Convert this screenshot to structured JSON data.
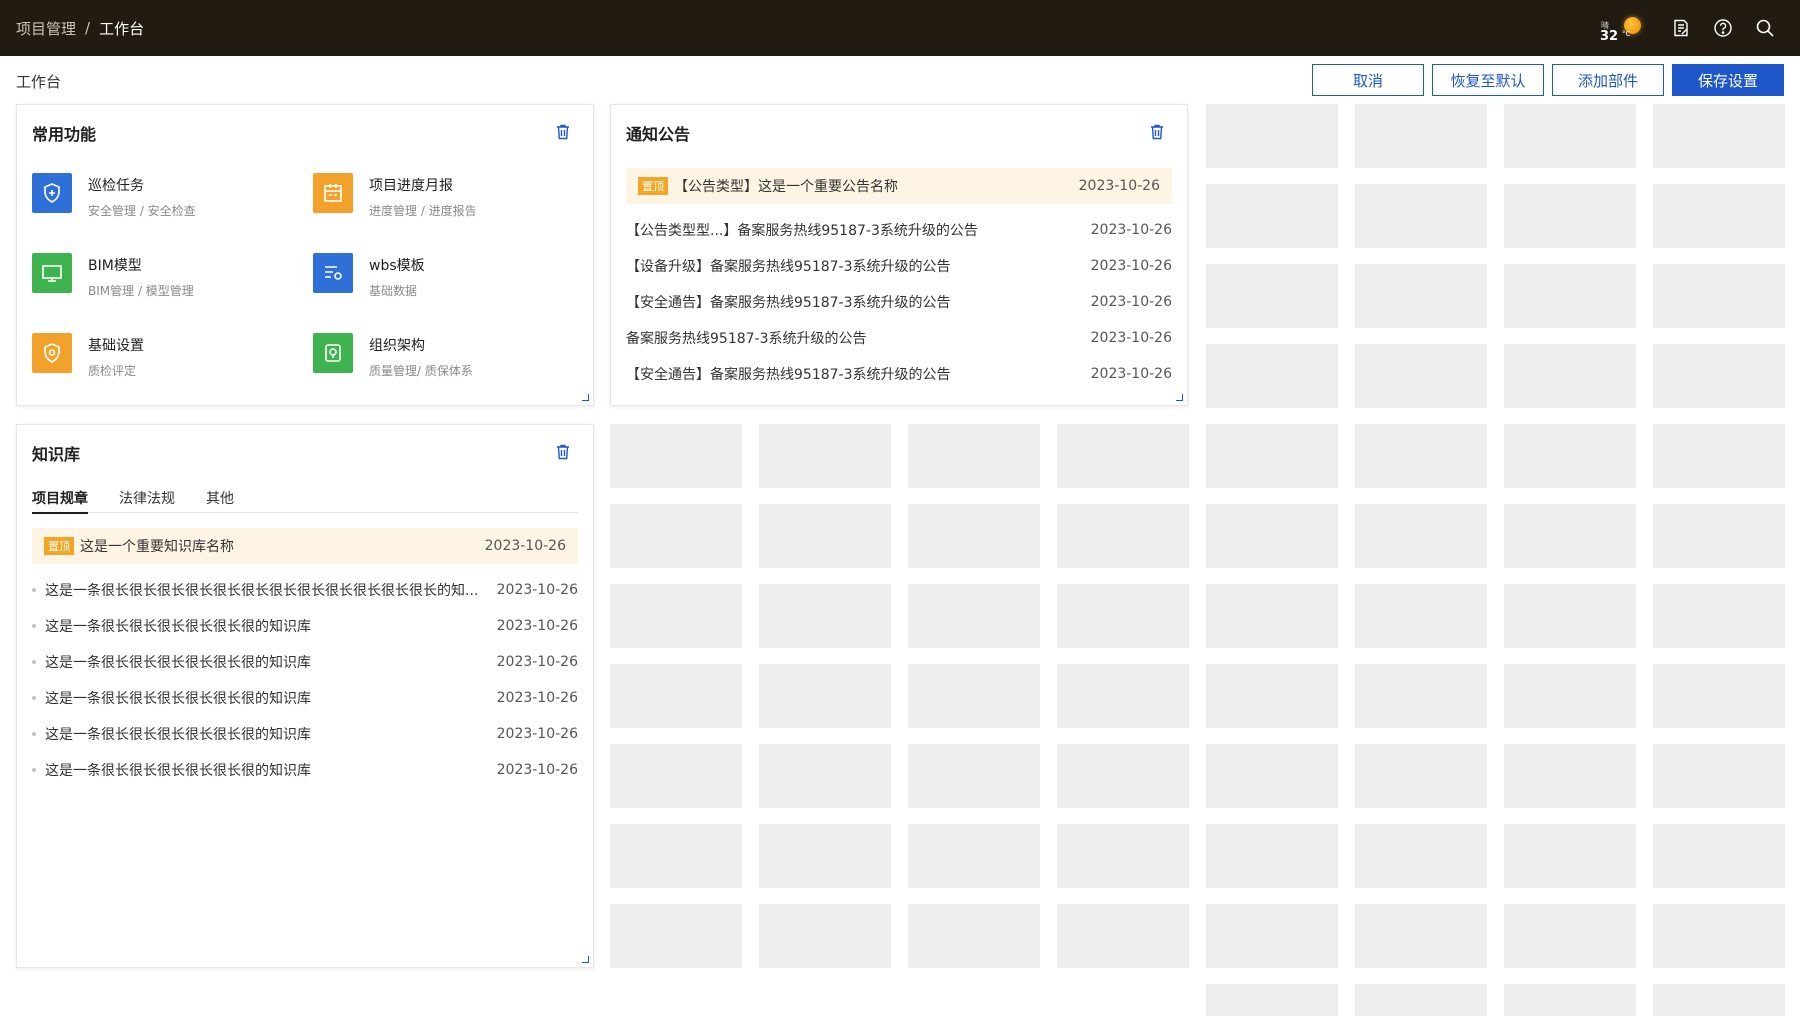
{
  "breadcrumb": {
    "parent": "项目管理",
    "separator": "/",
    "current": "工作台"
  },
  "weather": {
    "condition": "晴",
    "temperature": "32",
    "unit": "°C"
  },
  "topbar_icons": [
    "notes-icon",
    "help-icon",
    "search-icon"
  ],
  "page_title": "工作台",
  "actions": {
    "cancel": "取消",
    "reset": "恢复至默认",
    "add_widget": "添加部件",
    "save": "保存设置"
  },
  "colors": {
    "accent": "#1e58c8",
    "topbar": "#211b12",
    "pin_tag": "#f3a525",
    "pin_bg": "#fdf4e3",
    "placeholder": "#eeeeee"
  },
  "common_functions": {
    "title": "常用功能",
    "items": [
      {
        "name": "巡检任务",
        "sub": "安全管理 / 安全检查",
        "icon": "shield-icon",
        "color": "#2f6fd8"
      },
      {
        "name": "项目进度月报",
        "sub": "进度管理 / 进度报告",
        "icon": "calendar-icon",
        "color": "#f2a12b"
      },
      {
        "name": "BIM模型",
        "sub": "BIM管理 / 模型管理",
        "icon": "monitor-icon",
        "color": "#3fb34f"
      },
      {
        "name": "wbs模板",
        "sub": "基础数据",
        "icon": "settings-list-icon",
        "color": "#2f6fd8"
      },
      {
        "name": "基础设置",
        "sub": "质检评定",
        "icon": "settings-badge-icon",
        "color": "#f2a12b"
      },
      {
        "name": "组织架构",
        "sub": "质量管理/ 质保体系",
        "icon": "org-shield-icon",
        "color": "#3fb34f"
      }
    ]
  },
  "notices": {
    "title": "通知公告",
    "pinned": {
      "tag": "置顶",
      "text": "【公告类型】这是一个重要公告名称",
      "date": "2023-10-26"
    },
    "items": [
      {
        "text": "【公告类型型...】备案服务热线95187-3系统升级的公告",
        "date": "2023-10-26"
      },
      {
        "text": "【设备升级】备案服务热线95187-3系统升级的公告",
        "date": "2023-10-26"
      },
      {
        "text": "【安全通告】备案服务热线95187-3系统升级的公告",
        "date": "2023-10-26"
      },
      {
        "text": "备案服务热线95187-3系统升级的公告",
        "date": "2023-10-26"
      },
      {
        "text": "【安全通告】备案服务热线95187-3系统升级的公告",
        "date": "2023-10-26"
      }
    ]
  },
  "knowledge": {
    "title": "知识库",
    "tabs": [
      "项目规章",
      "法律法规",
      "其他"
    ],
    "active_tab": "项目规章",
    "pinned": {
      "tag": "置顶",
      "text": "这是一个重要知识库名称",
      "date": "2023-10-26"
    },
    "items": [
      {
        "text": "这是一条很长很长很长很长很长很长很长很长很长很长很长很长的知...",
        "date": "2023-10-26"
      },
      {
        "text": "这是一条很长很长很长很长很长很的知识库",
        "date": "2023-10-26"
      },
      {
        "text": "这是一条很长很长很长很长很长很的知识库",
        "date": "2023-10-26"
      },
      {
        "text": "这是一条很长很长很长很长很长很的知识库",
        "date": "2023-10-26"
      },
      {
        "text": "这是一条很长很长很长很长很长很的知识库",
        "date": "2023-10-26"
      },
      {
        "text": "这是一条很长很长很长很长很长很的知识库",
        "date": "2023-10-26"
      }
    ]
  }
}
